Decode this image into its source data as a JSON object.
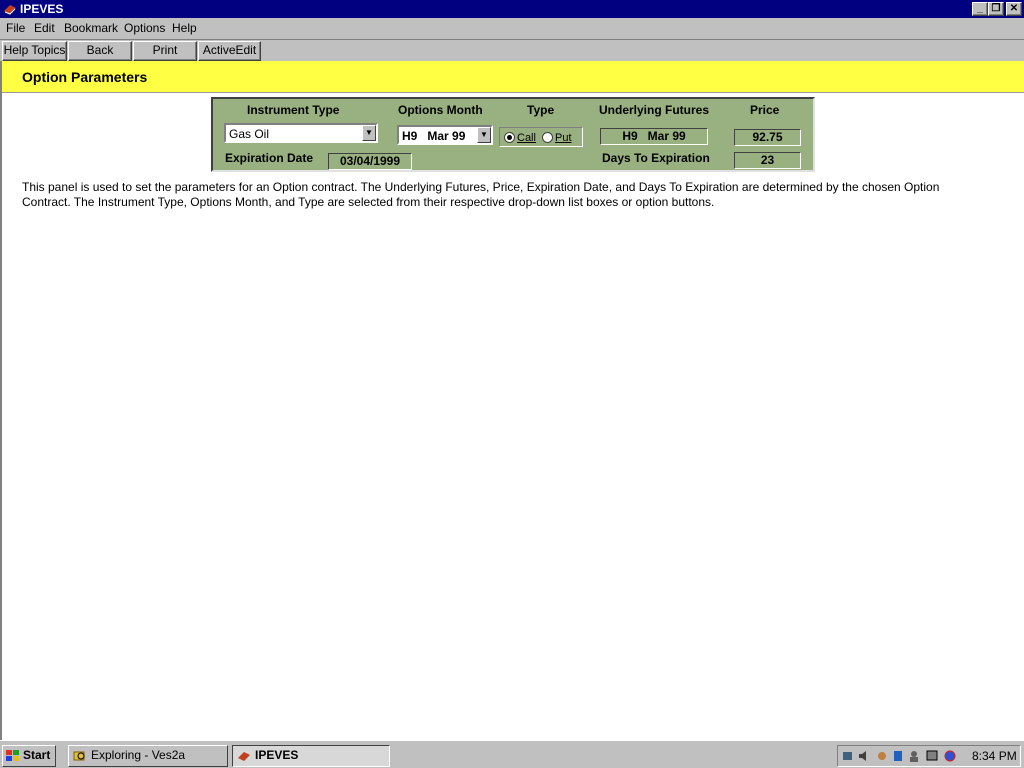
{
  "window": {
    "title": "IPEVES"
  },
  "menubar": {
    "file": "File",
    "edit": "Edit",
    "bookmark": "Bookmark",
    "options": "Options",
    "help": "Help"
  },
  "buttons": {
    "help_topics": "Help Topics",
    "back": "Back",
    "print": "Print",
    "active_edit": "ActiveEdit"
  },
  "page": {
    "title": "Option Parameters"
  },
  "panel": {
    "instrument_type_label": "Instrument Type",
    "instrument_type_value": "Gas Oil",
    "options_month_label": "Options Month",
    "options_month_value": "H9   Mar 99",
    "type_label": "Type",
    "type_call": "Call",
    "type_put": "Put",
    "type_selected": "Call",
    "underlying_futures_label": "Underlying Futures",
    "underlying_futures_value": "H9   Mar 99",
    "price_label": "Price",
    "price_value": "92.75",
    "expiration_date_label": "Expiration Date",
    "expiration_date_value": "03/04/1999",
    "days_to_expiration_label": "Days To Expiration",
    "days_to_expiration_value": "23"
  },
  "description": "This panel is used to set the parameters for an Option contract.  The Underlying Futures, Price, Expiration Date, and Days To Expiration are determined by the chosen Option Contract.  The Instrument Type, Options Month, and Type are selected from their respective drop-down list boxes or option buttons.",
  "taskbar": {
    "start": "Start",
    "task_exploring": "Exploring - Ves2a",
    "task_ipeves": "IPEVES",
    "clock": "8:34 PM"
  },
  "colors": {
    "title_bar": "#000080",
    "header_band": "#ffff44",
    "panel": "#99b080"
  }
}
